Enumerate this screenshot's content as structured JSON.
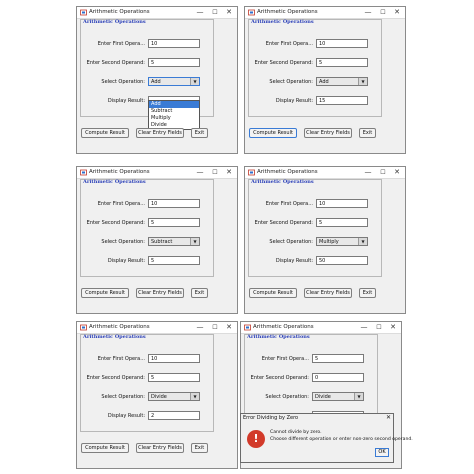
{
  "app": {
    "title": "Arithmetic Operations",
    "panel_title": "Arithmetic Operations",
    "labels": {
      "first": "Enter First Opera...",
      "second": "Enter Second Operand:",
      "select": "Select Operation:",
      "result": "Display Result:"
    },
    "buttons": {
      "compute": "Compute Result",
      "clear": "Clear Entry Fields",
      "exit": "Exit"
    },
    "titlebar": {
      "minimize": "—",
      "maximize": "☐",
      "close": "✕"
    },
    "dropdown_arrow": "▼"
  },
  "windows": [
    {
      "first": "10",
      "second": "5",
      "operation": "Add",
      "result": "",
      "dropdown_open": true,
      "options": [
        "Add",
        "Subtract",
        "Multiply",
        "Divide"
      ],
      "highlighted": "Add"
    },
    {
      "first": "10",
      "second": "5",
      "operation": "Add",
      "result": "15"
    },
    {
      "first": "10",
      "second": "5",
      "operation": "Subtract",
      "result": "5"
    },
    {
      "first": "10",
      "second": "5",
      "operation": "Multiply",
      "result": "50"
    },
    {
      "first": "10",
      "second": "5",
      "operation": "Divide",
      "result": "2"
    },
    {
      "first": "5",
      "second": "0",
      "operation": "Divide",
      "result": ""
    }
  ],
  "error_dialog": {
    "title": "Error Dividing by Zero",
    "close": "✕",
    "icon": "error-icon",
    "icon_glyph": "!",
    "line1": "Cannot divide by zero.",
    "line2": "Choose different operation or enter non-zero second operand.",
    "ok": "OK"
  },
  "colors": {
    "accent": "#3a7bd5",
    "panel_title": "#2a3fb8",
    "error": "#d23a2a"
  }
}
